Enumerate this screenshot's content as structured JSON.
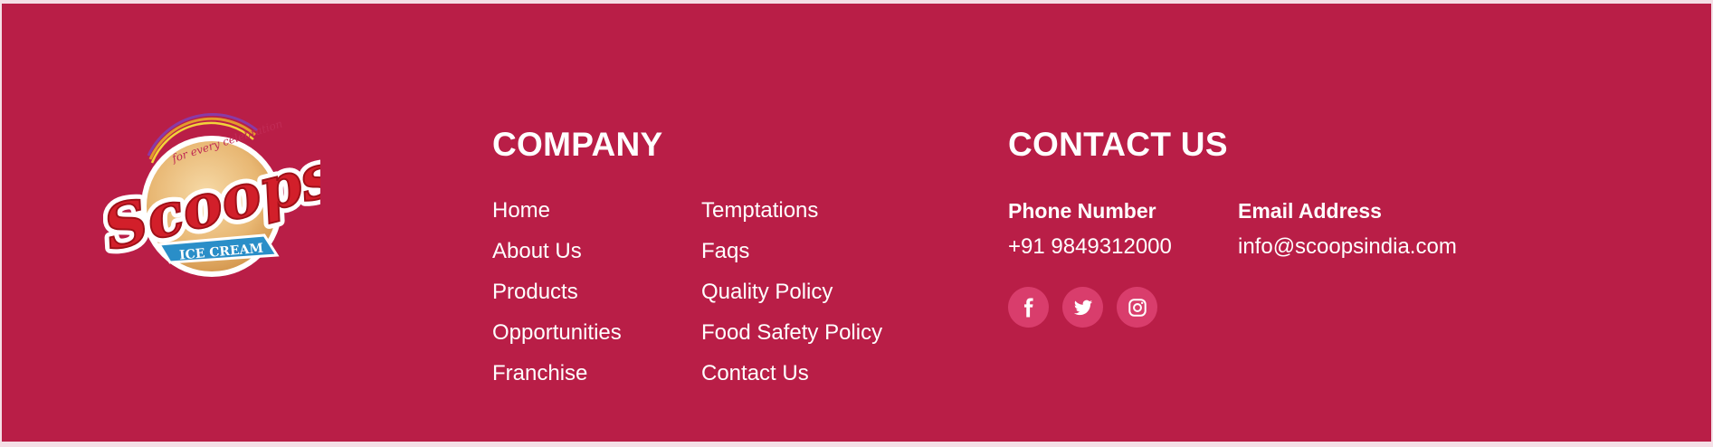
{
  "brand": {
    "logo_text": "Scoops",
    "logo_ribbon": "ICE CREAM",
    "logo_tagline": "for every celebration"
  },
  "company": {
    "title": "COMPANY",
    "links_left": [
      "Home",
      "About Us",
      "Products",
      "Opportunities",
      "Franchise"
    ],
    "links_right": [
      "Temptations",
      "Faqs",
      "Quality Policy",
      "Food Safety Policy",
      "Contact Us"
    ]
  },
  "contact": {
    "title": "CONTACT US",
    "phone_label": "Phone Number",
    "phone_value": "+91 9849312000",
    "email_label": "Email Address",
    "email_value": "info@scoopsindia.com",
    "social": [
      {
        "icon": "facebook-icon"
      },
      {
        "icon": "twitter-icon"
      },
      {
        "icon": "instagram-icon"
      }
    ]
  },
  "colors": {
    "footer_bg": "#b91e47",
    "social_bg": "#d93d6c",
    "text": "#ffffff"
  }
}
